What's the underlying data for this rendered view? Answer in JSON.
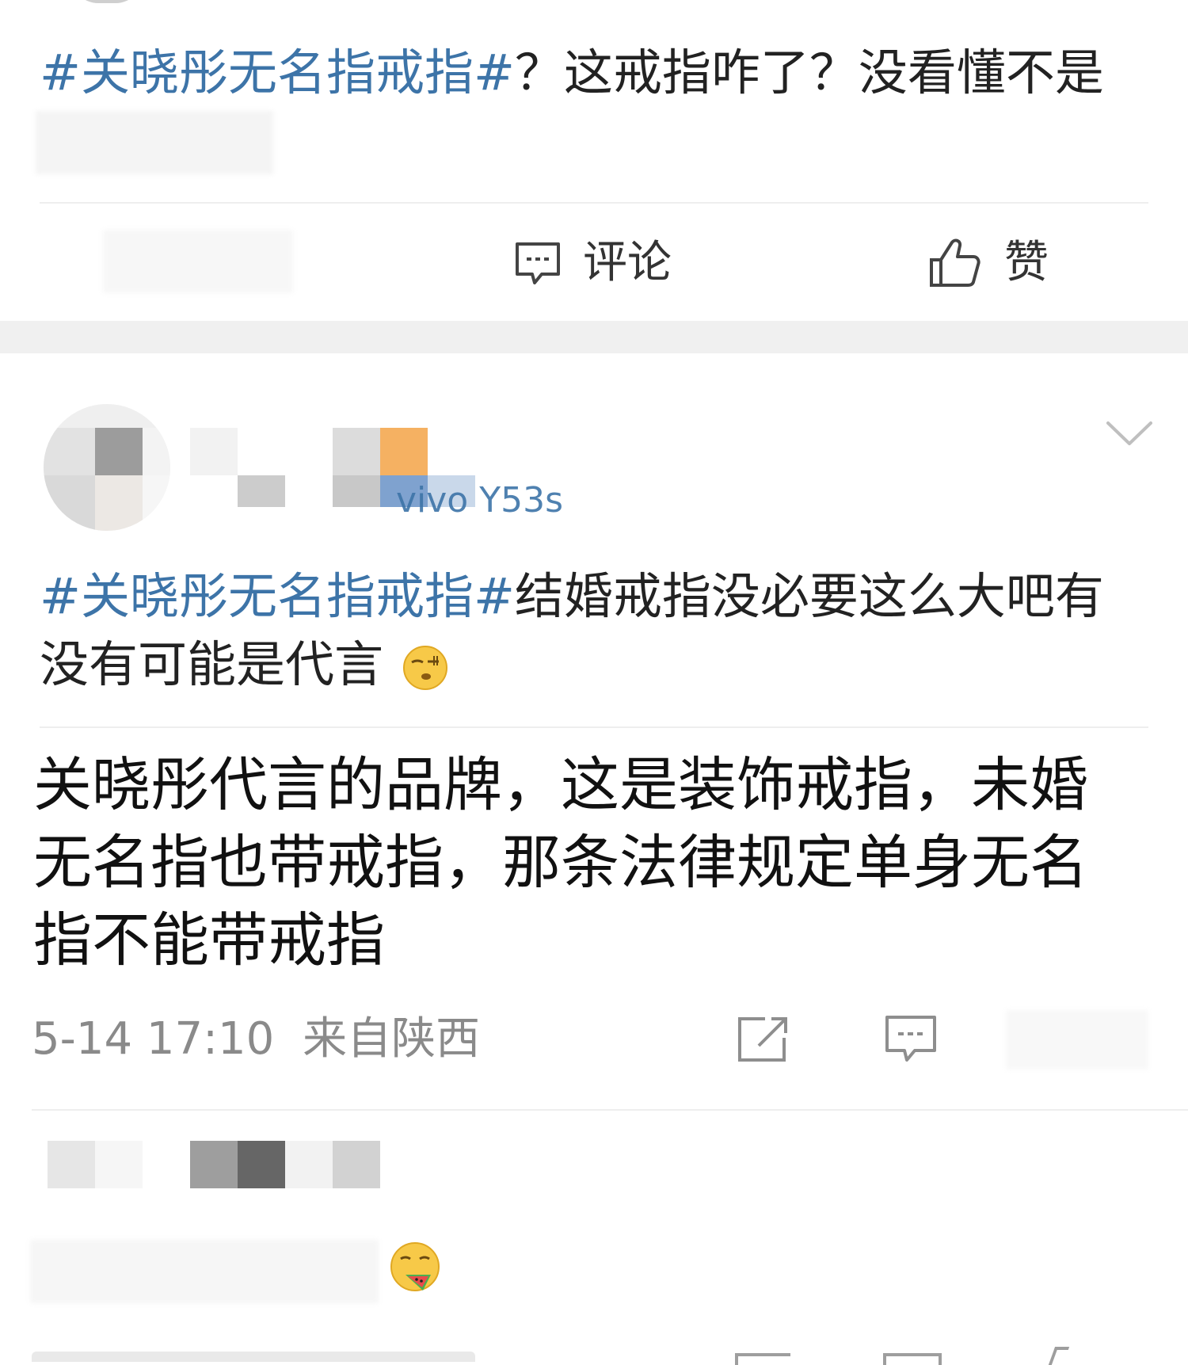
{
  "post1": {
    "topic": "#关晓彤无名指戒指#",
    "text": "？这戒指咋了？没看懂不是",
    "actions": {
      "comment_label": "评论",
      "like_label": "赞"
    }
  },
  "post2": {
    "source": "vivo Y53s",
    "topic": "#关晓彤无名指戒指#",
    "text_line1": "结婚戒指没必要这么大吧有",
    "text_line2": "没有可能是代言"
  },
  "reply": {
    "line1": "关晓彤代言的品牌，这是装饰戒指，未婚",
    "line2": "无名指也带戒指，那条法律规定单身无名",
    "line3": "指不能带戒指",
    "timestamp": "5-14 17:10",
    "location": "来自陕西"
  },
  "colors": {
    "topic": "#3d74a8",
    "text": "#222222",
    "meta": "#8a8a8a",
    "separator": "#f0f0f0",
    "divider": "#eeeeee"
  },
  "icons": {
    "comment": "comment-icon",
    "like": "thumb-up-icon",
    "share": "share-icon",
    "menu": "chevron-down-icon",
    "emoji_1": "smirk-emoji-icon",
    "emoji_2": "watermelon-emoji-icon"
  }
}
